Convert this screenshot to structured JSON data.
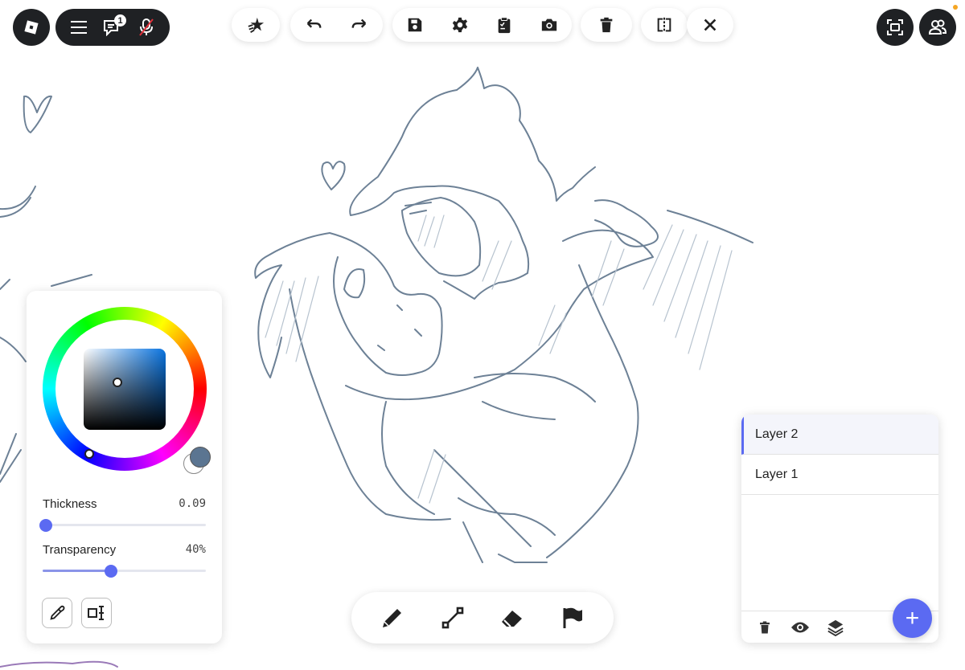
{
  "toolbar": {
    "top_left": {
      "chat_badge_count": "1"
    },
    "groups": [
      {
        "name": "effects",
        "buttons": [
          "sparkle-stars-icon"
        ]
      },
      {
        "name": "history",
        "buttons": [
          "undo-icon",
          "redo-icon"
        ]
      },
      {
        "name": "file",
        "buttons": [
          "save-icon",
          "gear-icon",
          "clipboard-icon",
          "camera-icon"
        ]
      },
      {
        "name": "clear",
        "buttons": [
          "trash-icon"
        ]
      },
      {
        "name": "mirror",
        "buttons": [
          "mirror-icon"
        ]
      },
      {
        "name": "close",
        "buttons": [
          "close-icon"
        ]
      }
    ]
  },
  "color_panel": {
    "primary_color": "#5b7591",
    "secondary_color": "#ffffff",
    "thickness": {
      "label": "Thickness",
      "value": "0.09",
      "level": 0.02
    },
    "transparency": {
      "label": "Transparency",
      "value": "40%",
      "level": 0.42
    }
  },
  "tools": [
    "pencil-icon",
    "line-tool-icon",
    "eraser-icon",
    "flag-icon"
  ],
  "layers": {
    "items": [
      {
        "label": "Layer 2",
        "active": true
      },
      {
        "label": "Layer 1",
        "active": false
      }
    ],
    "add_label": "+"
  },
  "colors": {
    "accent": "#5b6af2",
    "toolbar_dark": "#1f2124",
    "stroke": "#6d8196"
  }
}
